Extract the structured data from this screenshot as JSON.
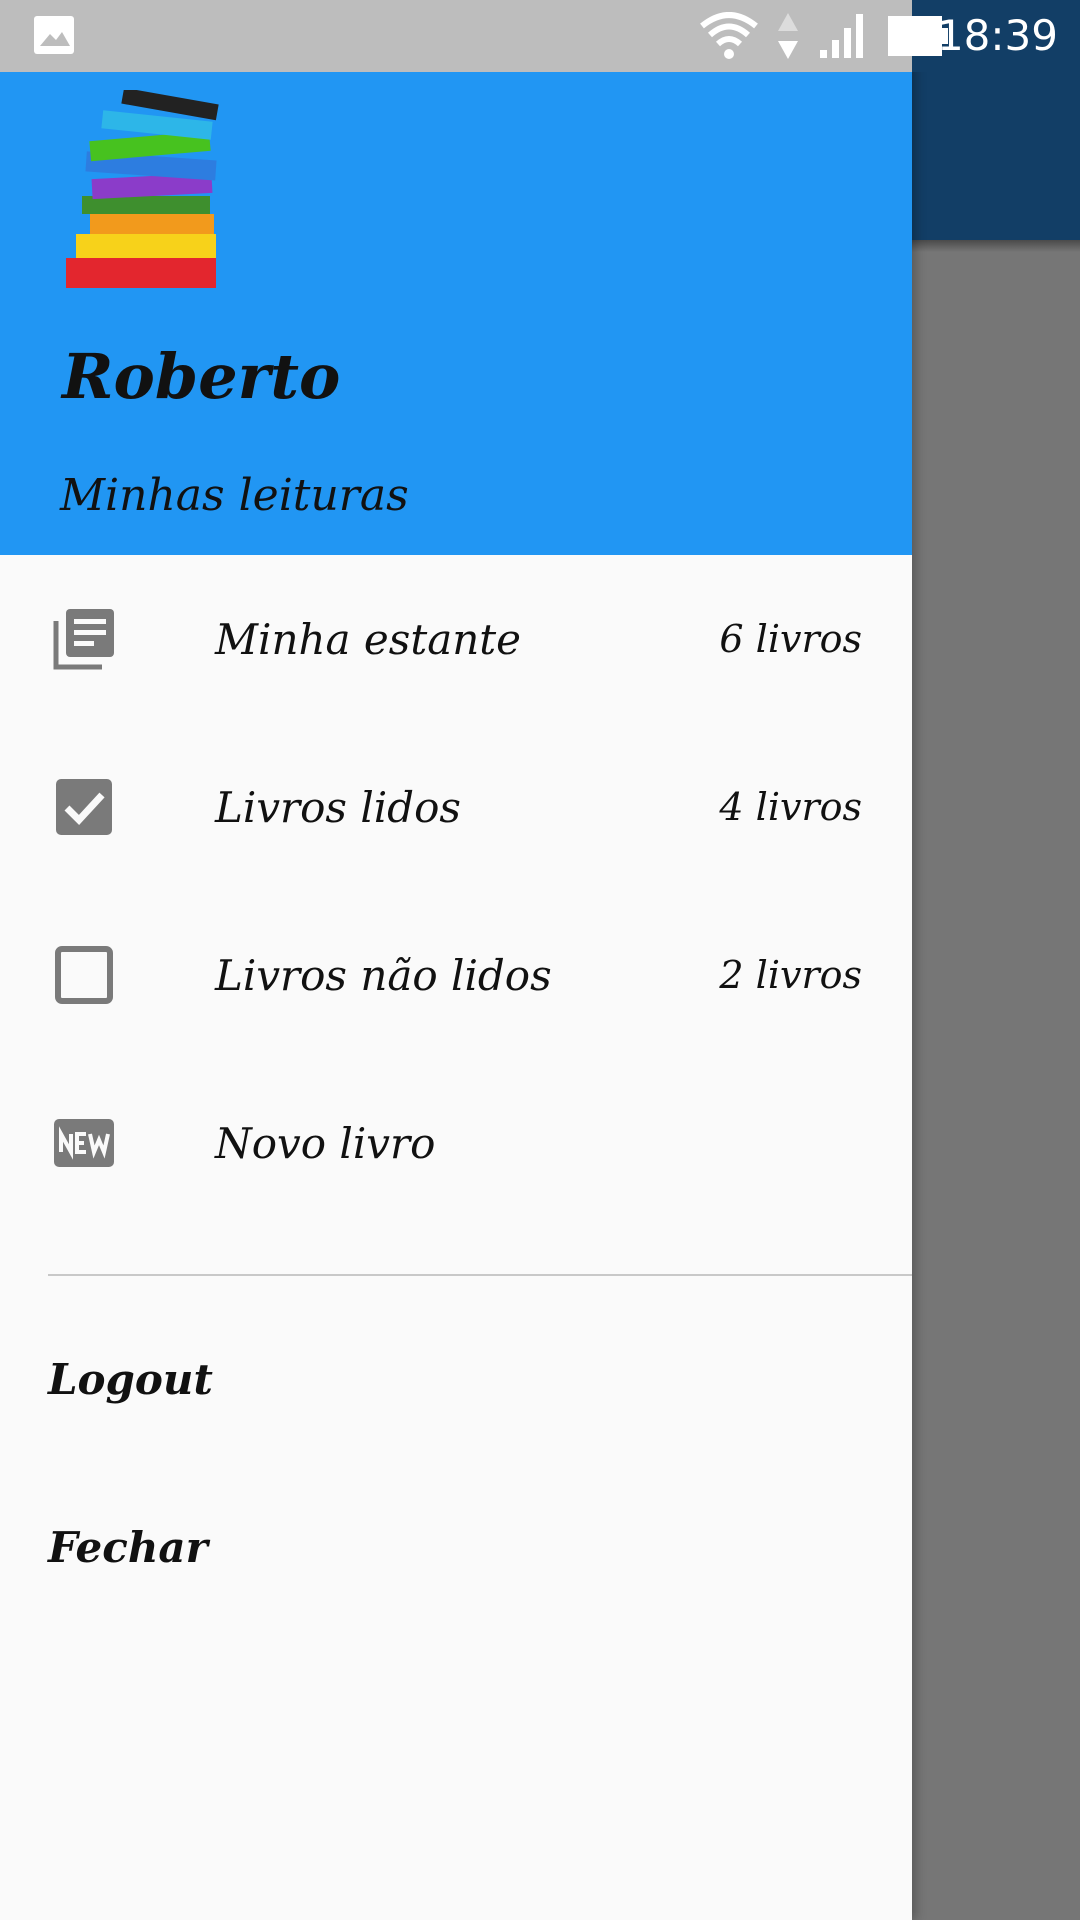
{
  "status_bar": {
    "time": "18:39",
    "icons": [
      "image-icon",
      "wifi-icon",
      "data-arrows-icon",
      "signal-icon",
      "battery-icon"
    ]
  },
  "drawer": {
    "header": {
      "logo": "books-stack-icon",
      "user_name": "Roberto",
      "subtitle": "Minhas leituras",
      "color": "#2196f3"
    },
    "items": [
      {
        "icon": "library-books-icon",
        "label": "Minha estante",
        "count": "6 livros"
      },
      {
        "icon": "checkbox-checked-icon",
        "label": "Livros lidos",
        "count": "4 livros"
      },
      {
        "icon": "checkbox-empty-icon",
        "label": "Livros não lidos",
        "count": "2 livros"
      },
      {
        "icon": "new-badge-icon",
        "label": "Novo livro",
        "count": ""
      }
    ],
    "actions": {
      "logout": "Logout",
      "close": "Fechar"
    }
  },
  "colors": {
    "app_toolbar": "#123e66",
    "scrim": "#757575",
    "icon_gray": "#7a7a7a"
  }
}
